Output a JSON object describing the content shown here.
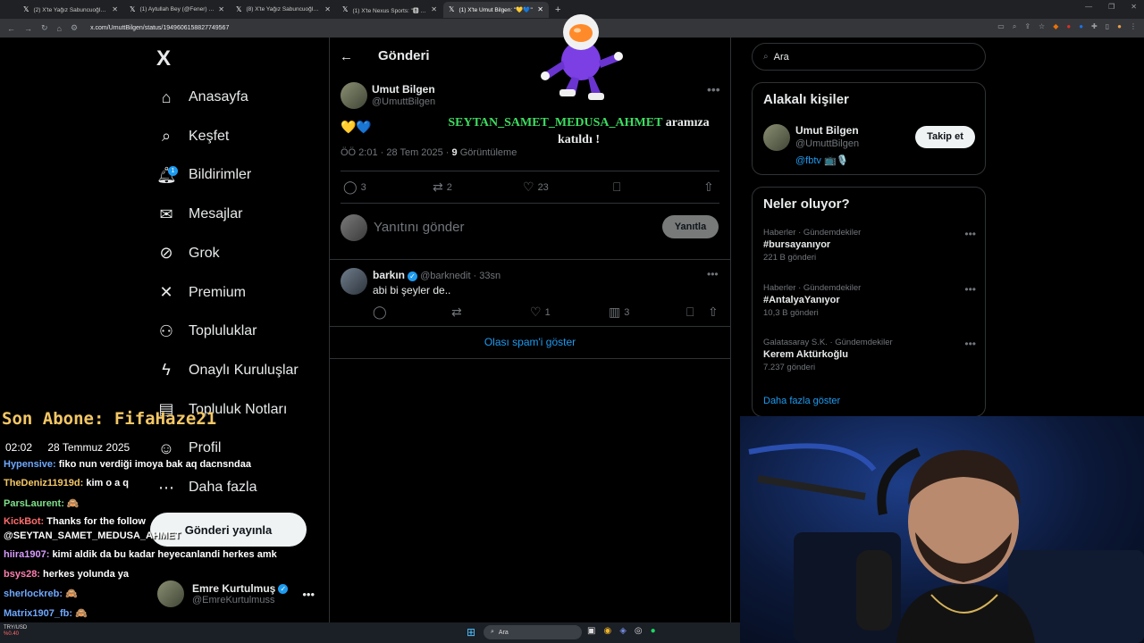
{
  "browser": {
    "tabs": [
      {
        "label": "(2) X'te Yağız Sabuncuoğlu: \"🏅",
        "active": false
      },
      {
        "label": "(1) Aytullah Bey (@Fener) adlı",
        "active": false
      },
      {
        "label": "(8) X'te Yağız Sabuncuoğlu: \"@",
        "active": false
      },
      {
        "label": "(1) X'te Nexus Sports: \"🅱 Bral",
        "active": false
      },
      {
        "label": "(1) X'te Umut Bilgen: \"💛💙\"",
        "active": true
      }
    ],
    "url": "x.com/UmuttBilgen/status/1949606158827749567"
  },
  "nav": {
    "logo": "X",
    "items": [
      {
        "label": "Anasayfa",
        "icon": "home-icon"
      },
      {
        "label": "Keşfet",
        "icon": "search-icon"
      },
      {
        "label": "Bildirimler",
        "icon": "bell-icon",
        "badge": "1"
      },
      {
        "label": "Mesajlar",
        "icon": "mail-icon"
      },
      {
        "label": "Grok",
        "icon": "grok-icon"
      },
      {
        "label": "Premium",
        "icon": "x-icon"
      },
      {
        "label": "Topluluklar",
        "icon": "people-icon"
      },
      {
        "label": "Onaylı Kuruluşlar",
        "icon": "lightning-icon"
      },
      {
        "label": "Topluluk Notları",
        "icon": "notes-icon"
      },
      {
        "label": "Profil",
        "icon": "profile-icon"
      },
      {
        "label": "Daha fazla",
        "icon": "more-circle-icon"
      }
    ],
    "post_button": "Gönderi yayınla",
    "account": {
      "name": "Emre Kurtulmuş",
      "handle": "@EmreKurtulmuss"
    }
  },
  "post": {
    "page_title": "Gönderi",
    "author_name": "Umut Bilgen",
    "author_handle": "@UmuttBilgen",
    "hearts": "💛💙",
    "overlay_highlight": "SEYTAN_SAMET_MEDUSA_AHMET",
    "overlay_rest": "aramıza katıldı !",
    "time": "ÖÖ 2:01 · 28 Tem 2025 ·",
    "views": "9",
    "views_label": "Görüntüleme",
    "stats": {
      "replies": "3",
      "reposts": "2",
      "likes": "23"
    },
    "reply_placeholder": "Yanıtını gönder",
    "reply_button": "Yanıtla"
  },
  "reply": {
    "name": "barkın",
    "handle": "@barknedit · 33sn",
    "text": "abi bi şeyler de..",
    "likes": "1",
    "views": "3"
  },
  "spam_link": "Olası spam'i göster",
  "right": {
    "search_placeholder": "Ara",
    "related_title": "Alakalı kişiler",
    "related": {
      "name": "Umut Bilgen",
      "handle": "@UmuttBilgen",
      "bio": "@fbtv 📺🎙️",
      "follow": "Takip et"
    },
    "trends_title": "Neler oluyor?",
    "trends": [
      {
        "category": "Haberler · Gündemdekiler",
        "name": "#bursayanıyor",
        "count": "221 B gönderi"
      },
      {
        "category": "Haberler · Gündemdekiler",
        "name": "#AntalyaYanıyor",
        "count": "10,3 B gönderi"
      },
      {
        "category": "Galatasaray S.K. · Gündemdekiler",
        "name": "Kerem Aktürkoğlu",
        "count": "7.237 gönderi"
      }
    ],
    "show_more": "Daha fazla göster"
  },
  "overlay": {
    "subscriber": "Son Abone: FifaHaze21",
    "time": "02:02",
    "date": "28 Temmuz 2025",
    "chat": [
      {
        "user": "Hypensive:",
        "msg": "fiko nun verdiği imoya bak aq dacnsndaa",
        "color": "#6fa8ff"
      },
      {
        "user": "TheDeniz11919d:",
        "msg": "kim o a q",
        "color": "#f3c766"
      },
      {
        "user": "ParsLaurent:",
        "msg": "🙈",
        "color": "#7ee08a"
      },
      {
        "user": "KickBot:",
        "msg": "Thanks for the follow",
        "color": "#ff6b6b"
      },
      {
        "user": "",
        "msg": "@SEYTAN_SAMET_MEDUSA_AHMET",
        "color": "#ffffff"
      },
      {
        "user": "hiira1907:",
        "msg": "kimi aldik da bu kadar heyecanlandi herkes amk",
        "color": "#d99cff"
      },
      {
        "user": "bsys28:",
        "msg": "herkes yolunda ya",
        "color": "#ff7fb0"
      },
      {
        "user": "sherlockreb:",
        "msg": "🙈",
        "color": "#6fa8ff"
      },
      {
        "user": "Matrix1907_fb:",
        "msg": "🙈",
        "color": "#6fa8ff"
      }
    ]
  },
  "taskbar": {
    "search": "Ara",
    "ticker": "TRY/USD",
    "ticker_value": "%0.40"
  }
}
